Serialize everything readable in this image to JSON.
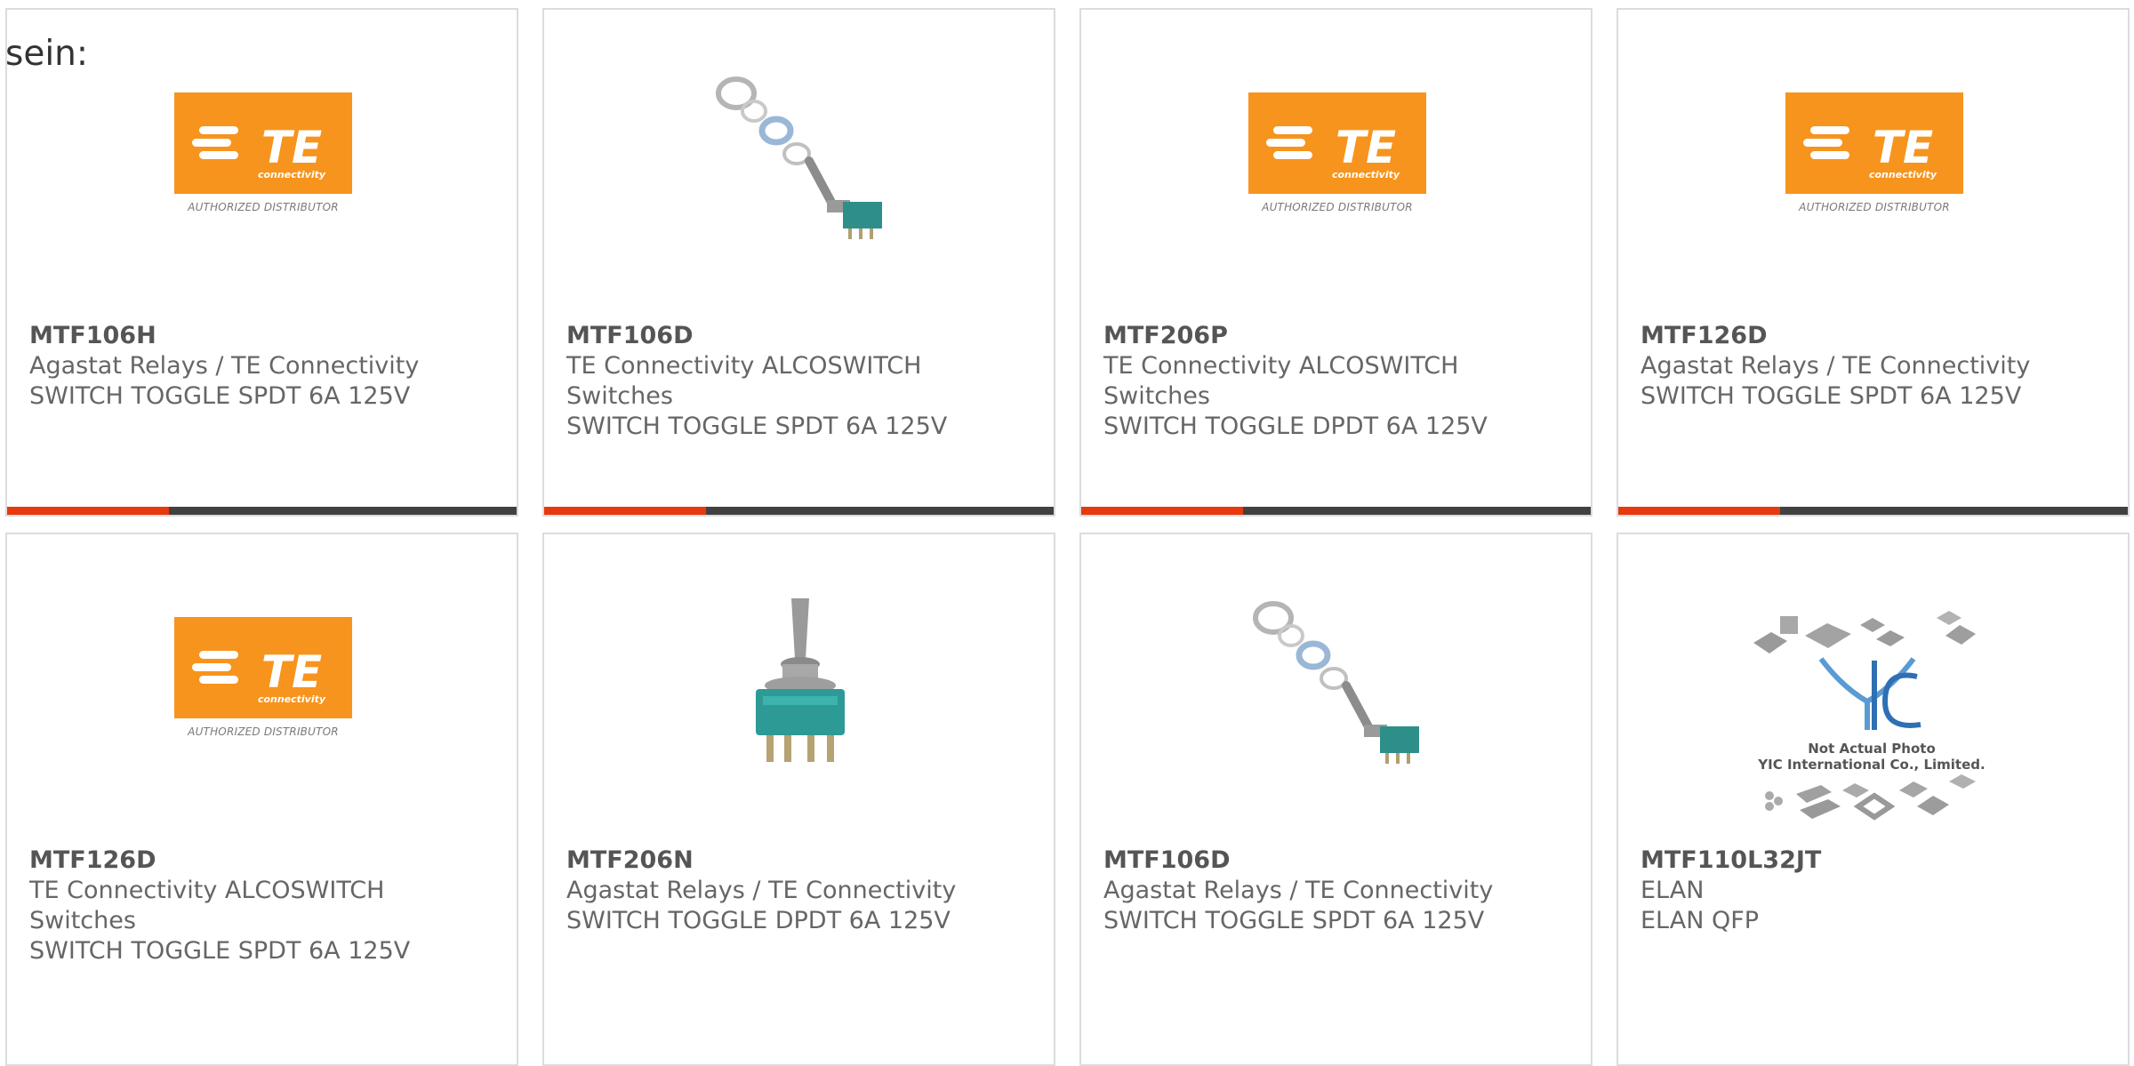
{
  "intro_text": "sein:",
  "colors": {
    "te_orange": "#f7941d",
    "bar_accent": "#e8380d",
    "bar_base": "#414141",
    "card_border": "#dcdcdc",
    "text": "#666666"
  },
  "logos": {
    "te_letters": "TE",
    "te_connectivity": "connectivity",
    "te_distributor": "AUTHORIZED DISTRIBUTOR",
    "yic_mark": "YIC",
    "yic_line1": "Not Actual Photo",
    "yic_line2": "YIC International Co., Limited."
  },
  "products": [
    {
      "image": "te-logo",
      "part_number": "MTF106H",
      "manufacturer": [
        "Agastat Relays / TE Connectivity"
      ],
      "description": "SWITCH TOGGLE SPDT 6A 125V"
    },
    {
      "image": "toggle-switch-hardware",
      "part_number": "MTF106D",
      "manufacturer": [
        "TE Connectivity ALCOSWITCH",
        "Switches"
      ],
      "description": "SWITCH TOGGLE SPDT 6A 125V"
    },
    {
      "image": "te-logo",
      "part_number": "MTF206P",
      "manufacturer": [
        "TE Connectivity ALCOSWITCH",
        "Switches"
      ],
      "description": "SWITCH TOGGLE DPDT 6A 125V"
    },
    {
      "image": "te-logo",
      "part_number": "MTF126D",
      "manufacturer": [
        "Agastat Relays / TE Connectivity"
      ],
      "description": "SWITCH TOGGLE SPDT 6A 125V"
    },
    {
      "image": "te-logo",
      "part_number": "MTF126D",
      "manufacturer": [
        "TE Connectivity ALCOSWITCH",
        "Switches"
      ],
      "description": "SWITCH TOGGLE SPDT 6A 125V"
    },
    {
      "image": "toggle-switch",
      "part_number": "MTF206N",
      "manufacturer": [
        "Agastat Relays / TE Connectivity"
      ],
      "description": "SWITCH TOGGLE DPDT 6A 125V"
    },
    {
      "image": "toggle-switch-hardware",
      "part_number": "MTF106D",
      "manufacturer": [
        "Agastat Relays / TE Connectivity"
      ],
      "description": "SWITCH TOGGLE SPDT 6A 125V"
    },
    {
      "image": "yic-placeholder",
      "part_number": "MTF110L32JT",
      "manufacturer": [
        "ELAN"
      ],
      "description": "ELAN QFP"
    }
  ]
}
